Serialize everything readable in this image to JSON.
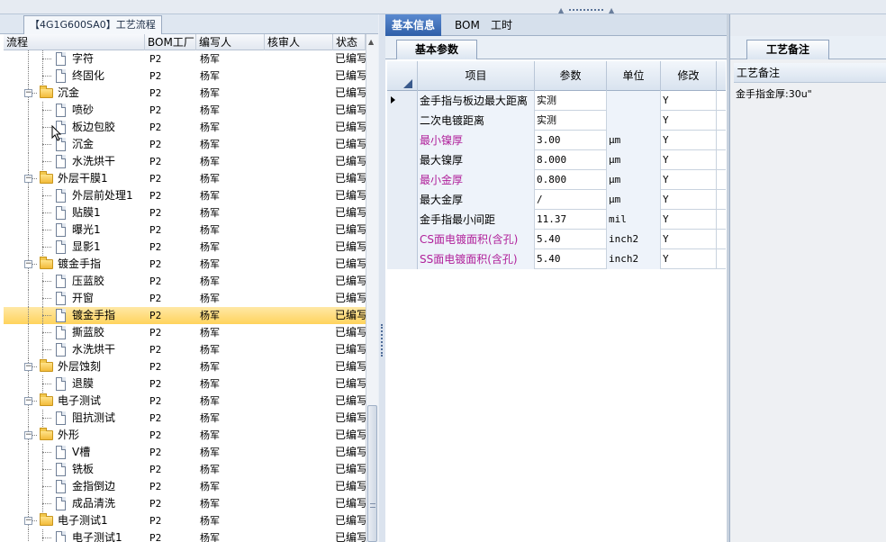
{
  "left_panel": {
    "title": "【4G1G600SA0】工艺流程",
    "columns": [
      "流程",
      "BOM工厂",
      "编写人",
      "核审人",
      "状态"
    ],
    "rows": [
      {
        "level": 2,
        "type": "doc",
        "name": "字符",
        "bom": "P2",
        "author": "杨军",
        "reviewer": "",
        "status": "已编写"
      },
      {
        "level": 2,
        "type": "doc",
        "name": "终固化",
        "bom": "P2",
        "author": "杨军",
        "reviewer": "",
        "status": "已编写"
      },
      {
        "level": 1,
        "type": "folder",
        "name": "沉金",
        "bom": "P2",
        "author": "杨军",
        "reviewer": "",
        "status": "已编写"
      },
      {
        "level": 2,
        "type": "doc",
        "name": "喷砂",
        "bom": "P2",
        "author": "杨军",
        "reviewer": "",
        "status": "已编写"
      },
      {
        "level": 2,
        "type": "doc",
        "name": "板边包胶",
        "bom": "P2",
        "author": "杨军",
        "reviewer": "",
        "status": "已编写"
      },
      {
        "level": 2,
        "type": "doc",
        "name": "沉金",
        "bom": "P2",
        "author": "杨军",
        "reviewer": "",
        "status": "已编写"
      },
      {
        "level": 2,
        "type": "doc",
        "name": "水洗烘干",
        "bom": "P2",
        "author": "杨军",
        "reviewer": "",
        "status": "已编写"
      },
      {
        "level": 1,
        "type": "folder",
        "name": "外层干膜1",
        "bom": "P2",
        "author": "杨军",
        "reviewer": "",
        "status": "已编写"
      },
      {
        "level": 2,
        "type": "doc",
        "name": "外层前处理1",
        "bom": "P2",
        "author": "杨军",
        "reviewer": "",
        "status": "已编写"
      },
      {
        "level": 2,
        "type": "doc",
        "name": "贴膜1",
        "bom": "P2",
        "author": "杨军",
        "reviewer": "",
        "status": "已编写"
      },
      {
        "level": 2,
        "type": "doc",
        "name": "曝光1",
        "bom": "P2",
        "author": "杨军",
        "reviewer": "",
        "status": "已编写"
      },
      {
        "level": 2,
        "type": "doc",
        "name": "显影1",
        "bom": "P2",
        "author": "杨军",
        "reviewer": "",
        "status": "已编写"
      },
      {
        "level": 1,
        "type": "folder",
        "name": "镀金手指",
        "bom": "P2",
        "author": "杨军",
        "reviewer": "",
        "status": "已编写"
      },
      {
        "level": 2,
        "type": "doc",
        "name": "压蓝胶",
        "bom": "P2",
        "author": "杨军",
        "reviewer": "",
        "status": "已编写"
      },
      {
        "level": 2,
        "type": "doc",
        "name": "开窗",
        "bom": "P2",
        "author": "杨军",
        "reviewer": "",
        "status": "已编写"
      },
      {
        "level": 2,
        "type": "doc",
        "name": "镀金手指",
        "bom": "P2",
        "author": "杨军",
        "reviewer": "",
        "status": "已编写",
        "selected": true
      },
      {
        "level": 2,
        "type": "doc",
        "name": "撕蓝胶",
        "bom": "P2",
        "author": "杨军",
        "reviewer": "",
        "status": "已编写"
      },
      {
        "level": 2,
        "type": "doc",
        "name": "水洗烘干",
        "bom": "P2",
        "author": "杨军",
        "reviewer": "",
        "status": "已编写"
      },
      {
        "level": 1,
        "type": "folder",
        "name": "外层蚀刻",
        "bom": "P2",
        "author": "杨军",
        "reviewer": "",
        "status": "已编写"
      },
      {
        "level": 2,
        "type": "doc",
        "name": "退膜",
        "bom": "P2",
        "author": "杨军",
        "reviewer": "",
        "status": "已编写"
      },
      {
        "level": 1,
        "type": "folder",
        "name": "电子测试",
        "bom": "P2",
        "author": "杨军",
        "reviewer": "",
        "status": "已编写"
      },
      {
        "level": 2,
        "type": "doc",
        "name": "阻抗测试",
        "bom": "P2",
        "author": "杨军",
        "reviewer": "",
        "status": "已编写"
      },
      {
        "level": 1,
        "type": "folder",
        "name": "外形",
        "bom": "P2",
        "author": "杨军",
        "reviewer": "",
        "status": "已编写"
      },
      {
        "level": 2,
        "type": "doc",
        "name": "V槽",
        "bom": "P2",
        "author": "杨军",
        "reviewer": "",
        "status": "已编写"
      },
      {
        "level": 2,
        "type": "doc",
        "name": "铣板",
        "bom": "P2",
        "author": "杨军",
        "reviewer": "",
        "status": "已编写"
      },
      {
        "level": 2,
        "type": "doc",
        "name": "金指倒边",
        "bom": "P2",
        "author": "杨军",
        "reviewer": "",
        "status": "已编写"
      },
      {
        "level": 2,
        "type": "doc",
        "name": "成品清洗",
        "bom": "P2",
        "author": "杨军",
        "reviewer": "",
        "status": "已编写"
      },
      {
        "level": 1,
        "type": "folder",
        "name": "电子测试1",
        "bom": "P2",
        "author": "杨军",
        "reviewer": "",
        "status": "已编写"
      },
      {
        "level": 2,
        "type": "doc",
        "name": "电子测试1",
        "bom": "P2",
        "author": "杨军",
        "reviewer": "",
        "status": "已编写"
      }
    ]
  },
  "top_tabs": [
    "基本信息",
    "BOM",
    "工时"
  ],
  "params_tab": "基本参数",
  "params_grid": {
    "columns": [
      "项目",
      "参数",
      "单位",
      "修改"
    ],
    "rows": [
      {
        "item": "金手指与板边最大距离",
        "value": "实测",
        "unit": "",
        "modify": "Y",
        "highlight": false,
        "current": true
      },
      {
        "item": "二次电镀距离",
        "value": "实测",
        "unit": "",
        "modify": "Y",
        "highlight": false
      },
      {
        "item": "最小镍厚",
        "value": "3.00",
        "unit": "μm",
        "modify": "Y",
        "highlight": true
      },
      {
        "item": "最大镍厚",
        "value": "8.000",
        "unit": "μm",
        "modify": "Y",
        "highlight": false
      },
      {
        "item": "最小金厚",
        "value": "0.800",
        "unit": "μm",
        "modify": "Y",
        "highlight": true
      },
      {
        "item": "最大金厚",
        "value": "/",
        "unit": "μm",
        "modify": "Y",
        "highlight": false
      },
      {
        "item": "金手指最小间距",
        "value": "11.37",
        "unit": "mil",
        "modify": "Y",
        "highlight": false
      },
      {
        "item": "CS面电镀面积(含孔)",
        "value": "5.40",
        "unit": "inch2",
        "modify": "Y",
        "highlight": true
      },
      {
        "item": "SS面电镀面积(含孔)",
        "value": "5.40",
        "unit": "inch2",
        "modify": "Y",
        "highlight": true
      }
    ]
  },
  "right_panel": {
    "tab": "工艺备注",
    "header": "工艺备注",
    "note": "金手指金厚:30u\""
  },
  "colors": {
    "highlight_text": "#b0209a",
    "selected_row": "#ffd35c",
    "active_tab": "#2f5fa8"
  }
}
